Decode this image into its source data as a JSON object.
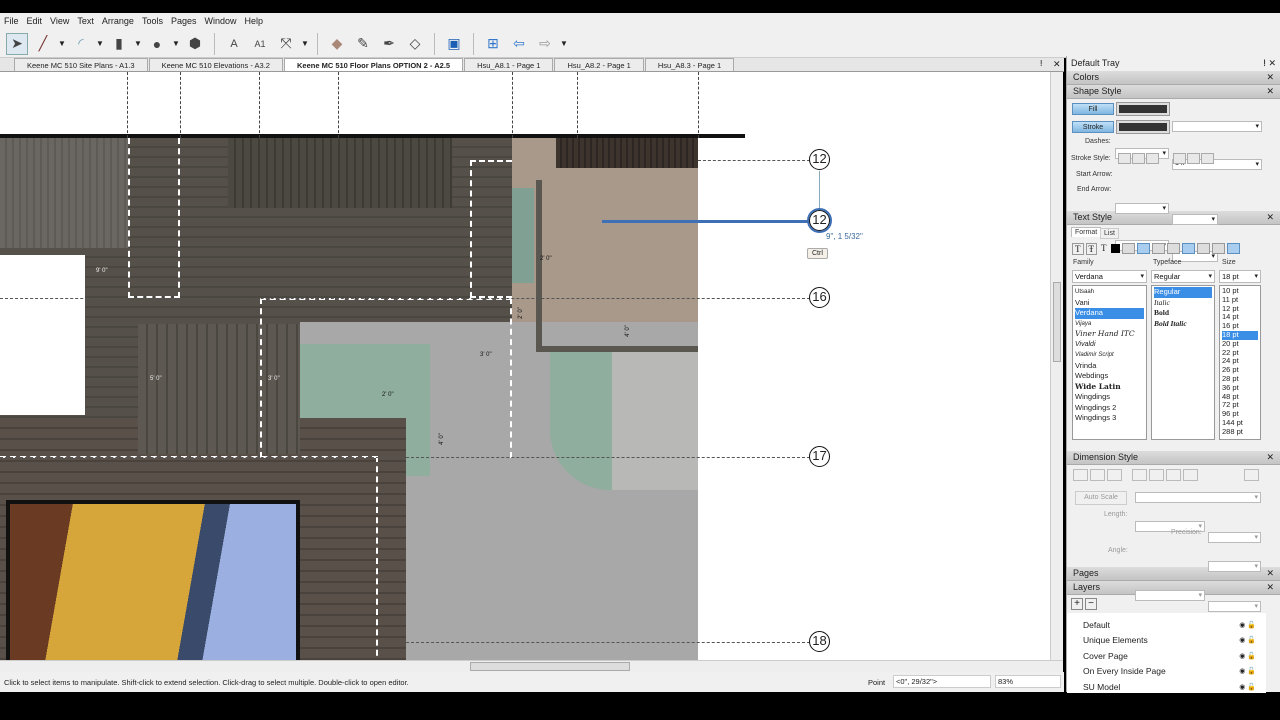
{
  "menu": [
    "File",
    "Edit",
    "View",
    "Text",
    "Arrange",
    "Tools",
    "Pages",
    "Window",
    "Help"
  ],
  "tabs": [
    "Keene MC 510 Site Plans - A1.3",
    "Keene MC 510 Elevations - A3.2",
    "Keene MC 510 Floor Plans OPTION 2 - A2.5",
    "Hsu_A8.1 - Page 1",
    "Hsu_A8.2 - Page 1",
    "Hsu_A8.3 - Page 1"
  ],
  "canvas": {
    "grid_labels": [
      "12",
      "12",
      "16",
      "17",
      "18"
    ],
    "cursor_readout": "9\", 1 5/32\"",
    "ctrl_tooltip": "Ctrl",
    "dims": [
      "9' 0\"",
      "2' 0\"",
      "2' 0\"",
      "4' 0\"",
      "3' 0\"",
      "5' 0\"",
      "3' 0\"",
      "2' 0\"",
      "4' 0\""
    ]
  },
  "status": {
    "hint": "Click to select items to manipulate. Shift-click to extend selection. Click-drag to select multiple. Double-click to open editor.",
    "point_label": "Point",
    "point_value": "<0\", 29/32\">",
    "zoom": "83%"
  },
  "tray": {
    "title": "Default Tray",
    "colors": "Colors",
    "shape_style": {
      "title": "Shape Style",
      "fill": "Fill",
      "stroke": "Stroke",
      "dashes": "Dashes:",
      "dash_scale": "1 x",
      "stroke_style": "Stroke Style:",
      "start_arrow": "Start Arrow:",
      "end_arrow": "End Arrow:"
    },
    "text_style": {
      "title": "Text Style",
      "tab_format": "Format",
      "tab_list": "List",
      "family_label": "Family",
      "typeface_label": "Typeface",
      "size_label": "Size",
      "family": "Verdana",
      "typeface": "Regular",
      "size": "18 pt",
      "families": [
        "Utsaah",
        "Vani",
        "Verdana",
        "Vijaya",
        "Viner Hand ITC",
        "Vivaldi",
        "Vladimir Script",
        "Vrinda",
        "Webdings",
        "Wide Latin",
        "Wingdings",
        "Wingdings 2",
        "Wingdings 3"
      ],
      "typefaces": [
        "Regular",
        "Italic",
        "Bold",
        "Bold Italic"
      ],
      "sizes": [
        "10 pt",
        "11 pt",
        "12 pt",
        "14 pt",
        "16 pt",
        "18 pt",
        "20 pt",
        "22 pt",
        "24 pt",
        "26 pt",
        "28 pt",
        "36 pt",
        "48 pt",
        "72 pt",
        "96 pt",
        "144 pt",
        "288 pt"
      ]
    },
    "dimension_style": {
      "title": "Dimension Style",
      "auto_scale": "Auto Scale",
      "length": "Length:",
      "precision": "Precision:",
      "angle": "Angle:"
    },
    "pages": "Pages",
    "layers": {
      "title": "Layers",
      "items": [
        "Default",
        "Unique Elements",
        "Cover Page",
        "On Every Inside Page",
        "SU Model"
      ]
    }
  }
}
